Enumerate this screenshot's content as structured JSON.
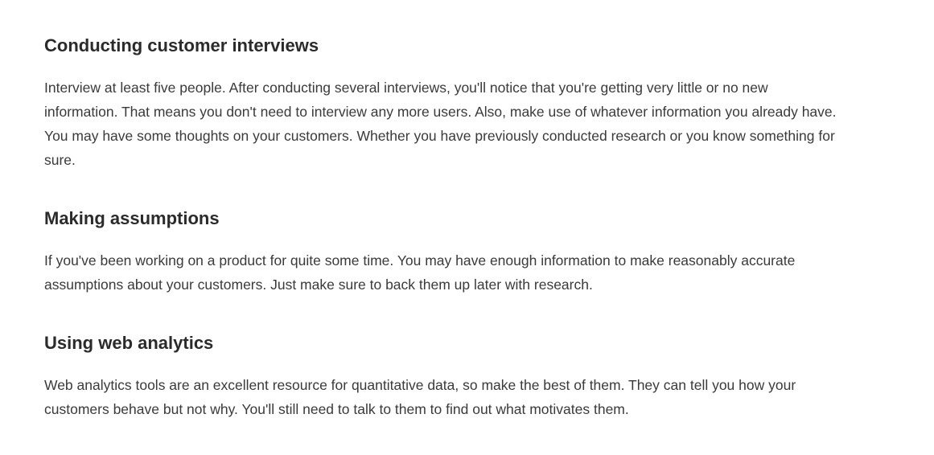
{
  "sections": [
    {
      "heading": "Conducting customer interviews",
      "body": "Interview at least five people. After conducting several interviews, you'll notice that you're getting very little or no new information. That means you don't need to interview any more users. Also, make use of whatever information you already have. You may have some thoughts on your customers. Whether you have previously conducted research or you know something for sure."
    },
    {
      "heading": "Making assumptions",
      "body": "If you've been working on a product for quite some time. You may have enough information to make reasonably accurate assumptions about your customers. Just make sure to back them up later with research."
    },
    {
      "heading": "Using web analytics",
      "body": "Web analytics tools are an excellent resource for quantitative data, so make the best of them. They can tell you how your customers behave but not why. You'll still need to talk to them to find out what motivates them."
    }
  ]
}
